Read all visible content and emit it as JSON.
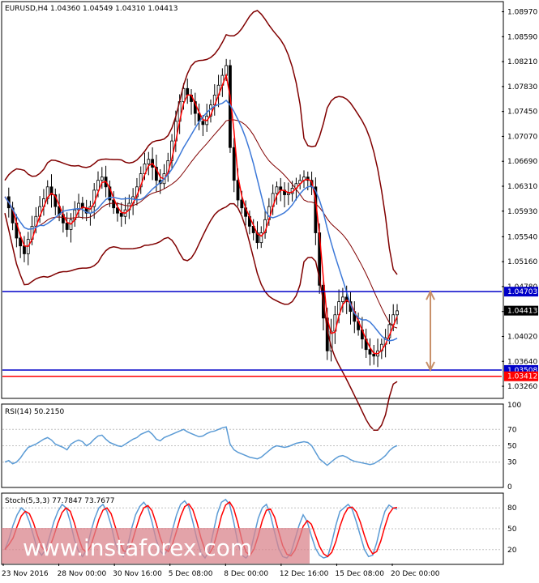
{
  "chart_data": [
    {
      "type": "candlestick",
      "title": "EURUSD,H4  1.04360 1.04549 1.04310 1.04413",
      "symbol": "EURUSD",
      "timeframe": "H4",
      "ohlc_header": {
        "open": 1.0436,
        "high": 1.04549,
        "low": 1.0431,
        "close": 1.04413
      },
      "ylim": [
        1.031,
        1.091
      ],
      "y_ticks": [
        "1.08970",
        "1.08590",
        "1.08210",
        "1.07830",
        "1.07450",
        "1.07070",
        "1.06690",
        "1.06310",
        "1.05930",
        "1.05540",
        "1.05160",
        "1.04780",
        "1.04400",
        "1.04020",
        "1.03640",
        "1.03260"
      ],
      "x_ticks": [
        "23 Nov 2016",
        "28 Nov 00:00",
        "30 Nov 16:00",
        "5 Dec 08:00",
        "8 Dec 00:00",
        "12 Dec 16:00",
        "15 Dec 08:00",
        "20 Dec 00:00"
      ],
      "price_markers": [
        {
          "label": "1.04703",
          "value": 1.04703,
          "color": "#0000c8"
        },
        {
          "label": "1.04413",
          "value": 1.04413,
          "color": "#000000"
        },
        {
          "label": "1.03508",
          "value": 1.03508,
          "color": "#0000c8"
        },
        {
          "label": "1.03412",
          "value": 1.03412,
          "color": "#ff0000"
        }
      ],
      "horizontal_lines": [
        {
          "value": 1.04703,
          "color": "#0000c8"
        },
        {
          "value": 1.03508,
          "color": "#0000c8"
        },
        {
          "value": 1.03412,
          "color": "#ff0000"
        }
      ],
      "range_arrow": {
        "from": 1.04703,
        "to": 1.03508,
        "color": "#c8906a"
      },
      "close_series": [
        1.0615,
        1.0598,
        1.0575,
        1.0552,
        1.054,
        1.0528,
        1.055,
        1.057,
        1.0585,
        1.06,
        1.0612,
        1.063,
        1.0618,
        1.06,
        1.0588,
        1.0575,
        1.0565,
        1.058,
        1.0595,
        1.0605,
        1.0598,
        1.059,
        1.06,
        1.0625,
        1.064,
        1.0645,
        1.063,
        1.061,
        1.0598,
        1.059,
        1.0585,
        1.0595,
        1.0605,
        1.0615,
        1.063,
        1.065,
        1.0665,
        1.0672,
        1.066,
        1.064,
        1.0635,
        1.065,
        1.067,
        1.07,
        1.073,
        1.076,
        1.078,
        1.077,
        1.076,
        1.0742,
        1.073,
        1.0725,
        1.0738,
        1.0755,
        1.077,
        1.0785,
        1.08,
        1.0815,
        1.069,
        1.064,
        1.061,
        1.0598,
        1.0585,
        1.057,
        1.056,
        1.0545,
        1.056,
        1.058,
        1.06,
        1.062,
        1.063,
        1.0625,
        1.0618,
        1.062,
        1.0628,
        1.0635,
        1.064,
        1.0645,
        1.064,
        1.063,
        1.056,
        1.048,
        1.043,
        1.038,
        1.041,
        1.0435,
        1.0455,
        1.0462,
        1.0455,
        1.044,
        1.0425,
        1.0412,
        1.0398,
        1.0382,
        1.0375,
        1.0372,
        1.038,
        1.039,
        1.04,
        1.042,
        1.0435,
        1.0441
      ],
      "indicators": [
        "Bollinger Bands",
        "Moving Average (red)",
        "Moving Average (blue)"
      ]
    },
    {
      "type": "line",
      "title": "RSI(14) 50.2150",
      "indicator": "RSI",
      "period": 14,
      "current_value": 50.215,
      "ylim": [
        0,
        100
      ],
      "y_ticks": [
        "100",
        "70",
        "50",
        "30",
        "0"
      ],
      "levels": [
        70,
        50,
        30
      ],
      "values": [
        30,
        32,
        28,
        30,
        35,
        42,
        48,
        50,
        52,
        55,
        58,
        60,
        57,
        52,
        50,
        48,
        45,
        52,
        55,
        57,
        55,
        50,
        53,
        58,
        62,
        63,
        58,
        54,
        52,
        50,
        49,
        52,
        55,
        58,
        60,
        64,
        66,
        68,
        64,
        58,
        56,
        60,
        62,
        64,
        66,
        68,
        70,
        67,
        65,
        63,
        61,
        62,
        65,
        67,
        68,
        70,
        72,
        73,
        52,
        45,
        42,
        40,
        38,
        36,
        35,
        34,
        36,
        40,
        44,
        48,
        50,
        49,
        48,
        49,
        51,
        53,
        54,
        55,
        54,
        50,
        42,
        34,
        30,
        26,
        30,
        34,
        37,
        38,
        36,
        33,
        31,
        30,
        29,
        28,
        27,
        28,
        31,
        34,
        38,
        44,
        48,
        50.2
      ]
    },
    {
      "type": "line",
      "title": "Stoch(5,3,3) 77.7847 73.7677",
      "indicator": "Stochastic",
      "params": "5,3,3",
      "main_value": 77.7847,
      "signal_value": 73.7677,
      "ylim": [
        0,
        100
      ],
      "y_ticks": [
        "80",
        "50",
        "20"
      ],
      "levels": [
        80,
        50,
        20
      ],
      "main": [
        20,
        35,
        55,
        70,
        80,
        75,
        60,
        40,
        20,
        12,
        20,
        40,
        60,
        75,
        85,
        80,
        60,
        35,
        18,
        10,
        20,
        45,
        65,
        80,
        85,
        75,
        55,
        30,
        15,
        10,
        25,
        50,
        70,
        82,
        88,
        80,
        60,
        35,
        18,
        12,
        22,
        48,
        70,
        85,
        90,
        82,
        60,
        35,
        15,
        8,
        18,
        45,
        72,
        88,
        92,
        85,
        60,
        30,
        12,
        8,
        15,
        40,
        65,
        80,
        85,
        70,
        45,
        22,
        10,
        8,
        15,
        35,
        55,
        70,
        60,
        40,
        22,
        12,
        8,
        10,
        30,
        55,
        75,
        80,
        85,
        78,
        60,
        40,
        20,
        10,
        12,
        30,
        55,
        75,
        84,
        80,
        78
      ]
    },
    {
      "type": "watermark",
      "text": "www.instaforex.com"
    }
  ]
}
